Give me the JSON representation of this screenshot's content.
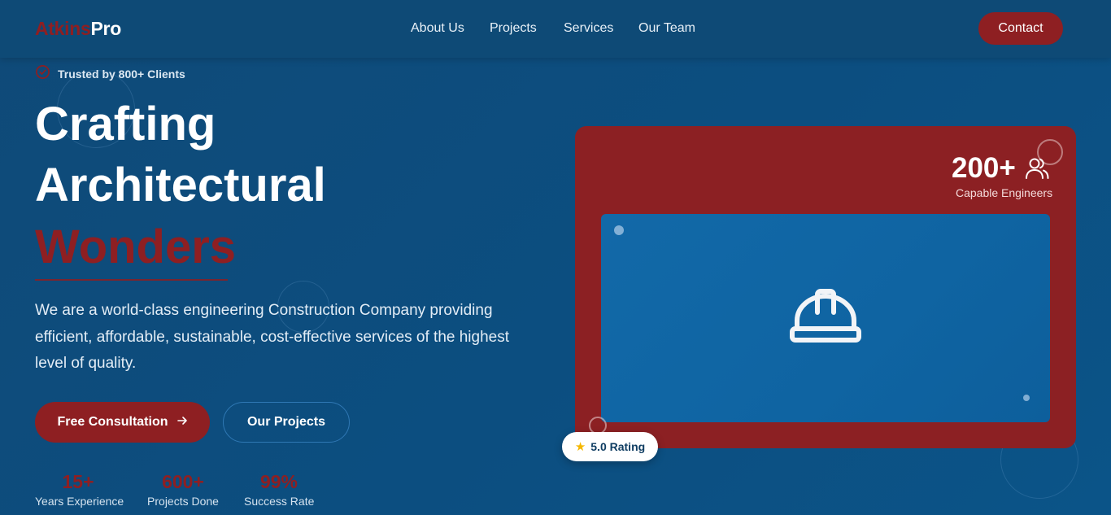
{
  "brand": {
    "part1": "Atkins",
    "part2": "Pro"
  },
  "nav": {
    "items": [
      {
        "label": "About Us"
      },
      {
        "label": "Projects"
      },
      {
        "label": "Services"
      },
      {
        "label": "Our Team"
      }
    ],
    "contact_label": "Contact"
  },
  "hero": {
    "badge": "Trusted by 800+ Clients",
    "title_line1": "Crafting",
    "title_line2": "Architectural",
    "title_line3": "Wonders",
    "description": "We are a world-class engineering Construction Company providing efficient, affordable, sustainable, cost-effective services of the highest level of quality.",
    "primary_cta": "Free Consultation",
    "secondary_cta": "Our Projects",
    "stats": [
      {
        "value": "15+",
        "label": "Years Experience"
      },
      {
        "value": "600+",
        "label": "Projects Done"
      },
      {
        "value": "99%",
        "label": "Success Rate"
      }
    ]
  },
  "showcase": {
    "engineers_count": "200+",
    "engineers_label": "Capable Engineers",
    "rating_label": "5.0 Rating",
    "rating_icon": "star-icon",
    "center_icon": "hard-hat-icon",
    "engineers_icon": "users-icon"
  },
  "colors": {
    "background": "#0d4d7e",
    "header": "#0e4a76",
    "accent": "#8e1f22",
    "card": "#8c2023",
    "inner_panel": "#1269a8"
  }
}
